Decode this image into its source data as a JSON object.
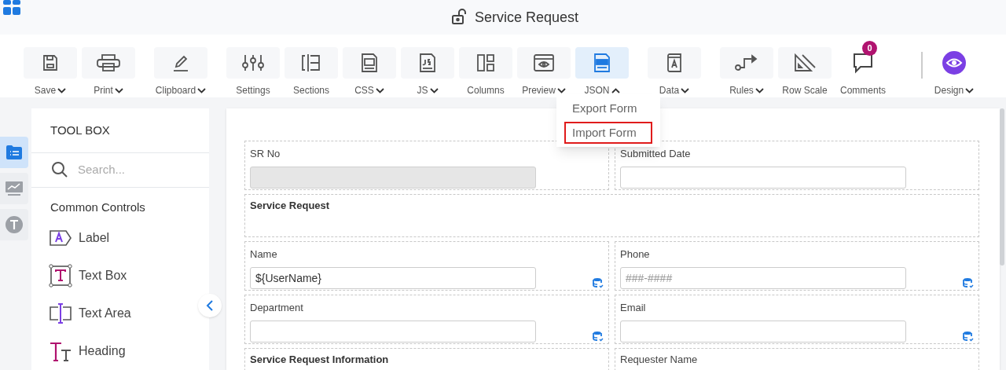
{
  "header": {
    "title": "Service Request"
  },
  "toolbar": [
    {
      "kind": "button",
      "label": "Save",
      "expanded": false,
      "selected": false
    },
    {
      "kind": "button",
      "label": "Print",
      "expanded": false,
      "selected": false
    },
    {
      "kind": "button",
      "label": "Clipboard",
      "expanded": false,
      "selected": false
    },
    {
      "kind": "button",
      "label": "Settings",
      "selected": false
    },
    {
      "kind": "button",
      "label": "Sections",
      "selected": false
    },
    {
      "kind": "button",
      "label": "CSS",
      "expanded": false,
      "selected": false
    },
    {
      "kind": "button",
      "label": "JS",
      "expanded": false,
      "selected": false
    },
    {
      "kind": "button",
      "label": "Columns",
      "selected": false
    },
    {
      "kind": "button",
      "label": "Preview",
      "expanded": false,
      "selected": false
    },
    {
      "kind": "button",
      "label": "JSON",
      "expanded": true,
      "selected": true
    },
    {
      "kind": "button",
      "label": "Data",
      "expanded": false,
      "selected": false
    },
    {
      "kind": "button",
      "label": "Rules",
      "expanded": false,
      "selected": false
    },
    {
      "kind": "button",
      "label": "Row Scale",
      "selected": false
    },
    {
      "kind": "plain",
      "label": "Comments",
      "badge": "0"
    },
    {
      "kind": "plain",
      "label": "Design",
      "expanded": false
    }
  ],
  "json_menu": [
    {
      "label": "Export Form",
      "highlighted": false
    },
    {
      "label": "Import Form",
      "highlighted": true
    }
  ],
  "rail": [
    {
      "selected": true
    },
    {
      "selected": false
    },
    {
      "selected": false
    }
  ],
  "toolbox": {
    "title": "TOOL BOX",
    "search_placeholder": "Search...",
    "section": "Common Controls",
    "items": [
      {
        "label": "Label"
      },
      {
        "label": "Text Box"
      },
      {
        "label": "Text Area"
      },
      {
        "label": "Heading"
      }
    ]
  },
  "form": {
    "rows": [
      [
        {
          "kind": "field",
          "label": "SR No",
          "disabled": true
        },
        {
          "kind": "field",
          "label": "Submitted Date",
          "disabled": false
        }
      ],
      [
        {
          "kind": "heading",
          "label": "Service Request"
        }
      ],
      [
        {
          "kind": "field",
          "label": "Name",
          "value": "${UserName}",
          "disabled": false,
          "bound": true
        },
        {
          "kind": "field",
          "label": "Phone",
          "placeholder": "###-####",
          "disabled": false,
          "bound": true
        }
      ],
      [
        {
          "kind": "field",
          "label": "Department",
          "disabled": false,
          "bound": true
        },
        {
          "kind": "field",
          "label": "Email",
          "disabled": false,
          "bound": true
        }
      ],
      [
        {
          "kind": "subheading",
          "label": "Service Request Information"
        },
        {
          "kind": "field-top",
          "label": "Requester Name"
        }
      ]
    ]
  }
}
